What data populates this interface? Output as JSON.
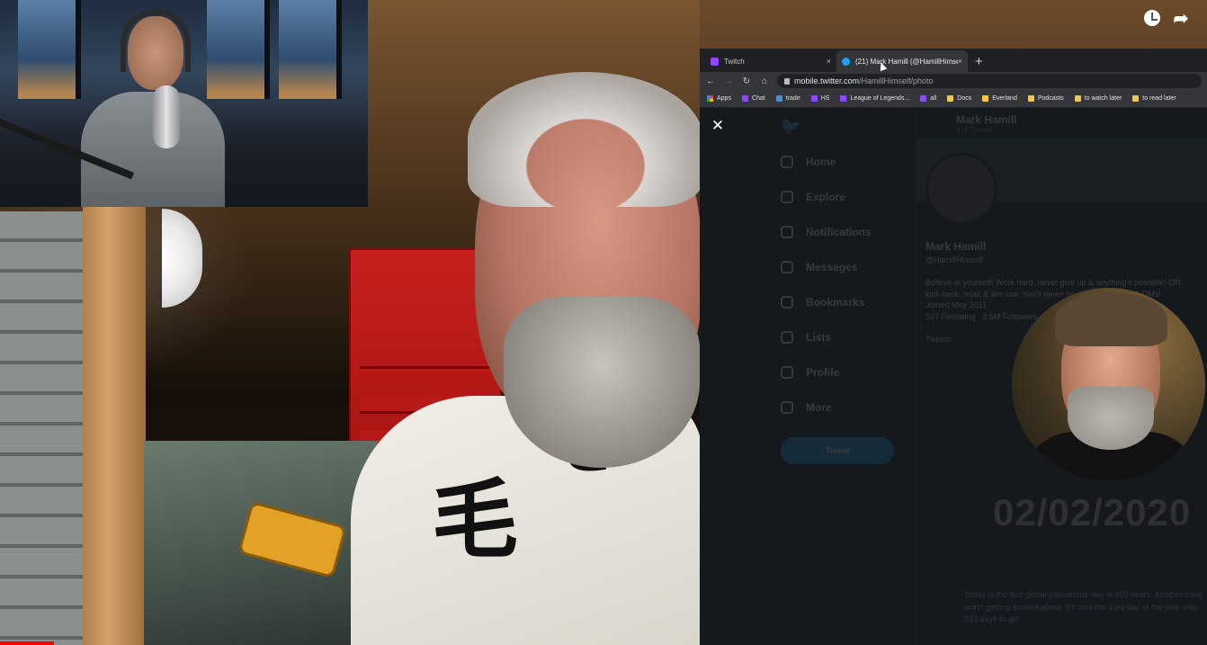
{
  "browser": {
    "tabs": [
      {
        "title": "Twitch",
        "icon": "twitch-icon",
        "active": false
      },
      {
        "title": "(21) Mark Hamill (@HamillHimself",
        "icon": "twitter-icon",
        "active": true
      }
    ],
    "new_tab_label": "+",
    "tab_close_label": "×",
    "url_domain": "mobile.twitter.com",
    "url_path": "/HamillHimself/photo",
    "bookmarks": [
      {
        "label": "Apps",
        "icon": "apps-grid-icon"
      },
      {
        "label": "Chat",
        "icon": "twitch-icon"
      },
      {
        "label": "trade",
        "icon": "bookmark-icon"
      },
      {
        "label": "HS",
        "icon": "twitch-icon"
      },
      {
        "label": "League of Legends...",
        "icon": "twitch-icon"
      },
      {
        "label": "all",
        "icon": "twitch-icon"
      },
      {
        "label": "Docs",
        "icon": "folder-icon"
      },
      {
        "label": "Everland",
        "icon": "folder-icon"
      },
      {
        "label": "Podcasts",
        "icon": "folder-icon"
      },
      {
        "label": "to watch later",
        "icon": "folder-icon"
      },
      {
        "label": "to read later",
        "icon": "folder-icon"
      }
    ]
  },
  "twitter": {
    "nav": [
      "Home",
      "Explore",
      "Notifications",
      "Messages",
      "Bookmarks",
      "Lists",
      "Profile",
      "More"
    ],
    "tweet_button": "Tweet",
    "profile_name": "Mark Hamill",
    "tweet_count": "17K Tweets",
    "handle": "@HamillHimself",
    "bio": "Believe in yourself! Work hard, never give up & anything's possible! OR: kick back, relax & aim low: You'll never be disappointed. NO DMs!",
    "joined": "Joined May 2011",
    "following": "527 Following",
    "followers": "3.6M Followers",
    "tweets_tab": "Tweets"
  },
  "overlay": {
    "close_label": "✕",
    "date": "02/02/2020",
    "tweet_text": "Today is the first global palindrome day in 909 years. Another thing worth getting excited about. It's also the 33rd day of the year with 333 days to go!"
  },
  "colors": {
    "twitch": "#9146ff",
    "twitter": "#1da1f2",
    "folder": "#f2c84b"
  }
}
